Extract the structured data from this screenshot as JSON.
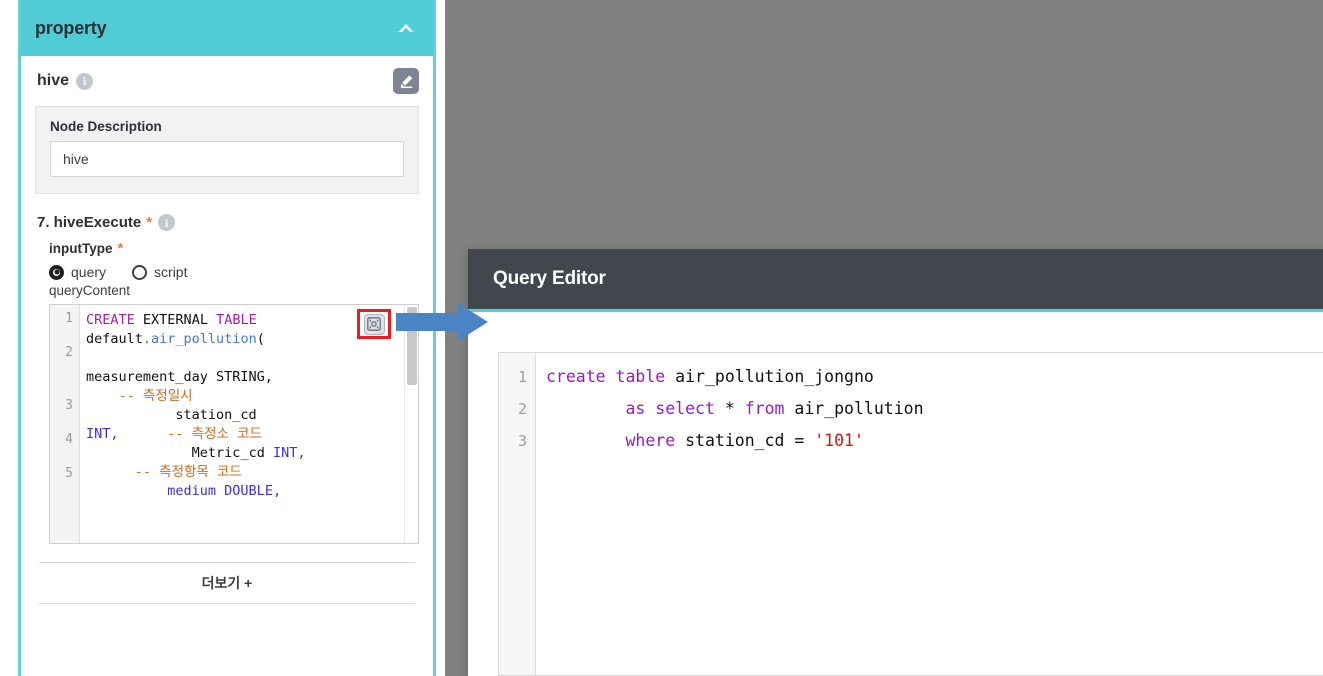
{
  "property_panel": {
    "header_title": "property",
    "collapse_icon": "chevron-up-icon",
    "node_name": "hive",
    "node_info_icon": "info-icon",
    "edit_icon": "pencil-edit-icon",
    "node_description_label": "Node Description",
    "node_description_value": "hive",
    "section_title": "7. hiveExecute",
    "required_star": "*",
    "section_info_icon": "info-icon",
    "input_type_label": "inputType",
    "radio_options": [
      {
        "label": "query",
        "selected": true
      },
      {
        "label": "script",
        "selected": false
      }
    ],
    "query_content_label": "queryContent",
    "expand_editor_icon": "expand-editor-icon",
    "more_label": "더보기 +",
    "code": {
      "line_numbers": [
        "1",
        "2",
        "3",
        "4",
        "5"
      ],
      "text": "CREATE EXTERNAL TABLE default.air_pollution(\n\nmeasurement_day STRING,        -- 측정일시\n                  station_cd INT,        -- 측정소 코드\n                  Metric_cd INT,\n            -- 측정항목 코드\n                  medium DOUBLE,"
    }
  },
  "dialog": {
    "title": "Query Editor",
    "code": {
      "line_numbers": [
        "1",
        "2",
        "3"
      ],
      "lines": [
        "create table air_pollution_jongno",
        "        as select * from air_pollution",
        "        where station_cd = '101'"
      ]
    }
  },
  "annotations": {
    "arrow_icon": "blue-right-arrow",
    "highlight_box_color": "#ee1c21"
  },
  "colors": {
    "panel_header_teal": "#50ccd6",
    "panel_border_teal": "#63d0d8",
    "dialog_header_dark": "#42464d",
    "dialog_accent_teal": "#4fd0da",
    "overlay_gray": "#818181",
    "required_orange": "#f07830",
    "arrow_blue": "#4a84c4",
    "highlight_red": "#ee1c21"
  }
}
